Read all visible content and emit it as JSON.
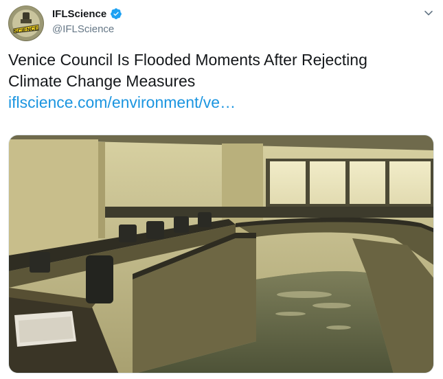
{
  "author": {
    "display_name": "IFLScience",
    "handle": "@IFLScience",
    "avatar_text": "SCIENCE",
    "verified_icon": "verified-badge-icon"
  },
  "tweet": {
    "text": "Venice Council Is Flooded Moments After Rejecting Climate Change Measures",
    "link": "iflscience.com/environment/ve…"
  },
  "media": {
    "description_icon": "photo",
    "alt": ""
  },
  "colors": {
    "link": "#1b95e0",
    "verified": "#1da1f2",
    "handle": "#657786"
  }
}
